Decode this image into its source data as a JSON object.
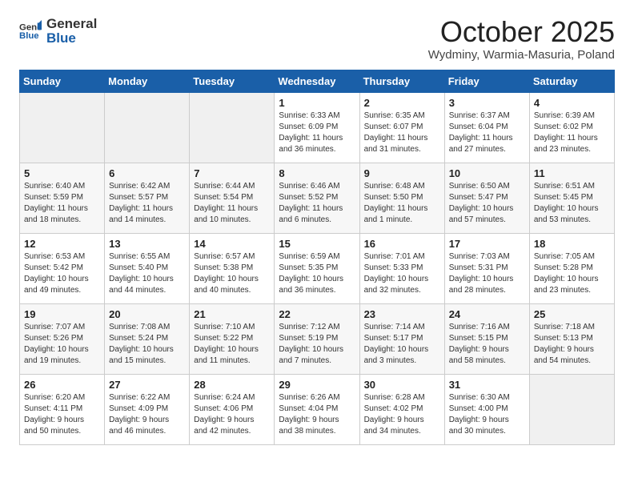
{
  "header": {
    "logo_general": "General",
    "logo_blue": "Blue",
    "title": "October 2025",
    "subtitle": "Wydminy, Warmia-Masuria, Poland"
  },
  "weekdays": [
    "Sunday",
    "Monday",
    "Tuesday",
    "Wednesday",
    "Thursday",
    "Friday",
    "Saturday"
  ],
  "weeks": [
    [
      {
        "day": "",
        "content": ""
      },
      {
        "day": "",
        "content": ""
      },
      {
        "day": "",
        "content": ""
      },
      {
        "day": "1",
        "content": "Sunrise: 6:33 AM\nSunset: 6:09 PM\nDaylight: 11 hours\nand 36 minutes."
      },
      {
        "day": "2",
        "content": "Sunrise: 6:35 AM\nSunset: 6:07 PM\nDaylight: 11 hours\nand 31 minutes."
      },
      {
        "day": "3",
        "content": "Sunrise: 6:37 AM\nSunset: 6:04 PM\nDaylight: 11 hours\nand 27 minutes."
      },
      {
        "day": "4",
        "content": "Sunrise: 6:39 AM\nSunset: 6:02 PM\nDaylight: 11 hours\nand 23 minutes."
      }
    ],
    [
      {
        "day": "5",
        "content": "Sunrise: 6:40 AM\nSunset: 5:59 PM\nDaylight: 11 hours\nand 18 minutes."
      },
      {
        "day": "6",
        "content": "Sunrise: 6:42 AM\nSunset: 5:57 PM\nDaylight: 11 hours\nand 14 minutes."
      },
      {
        "day": "7",
        "content": "Sunrise: 6:44 AM\nSunset: 5:54 PM\nDaylight: 11 hours\nand 10 minutes."
      },
      {
        "day": "8",
        "content": "Sunrise: 6:46 AM\nSunset: 5:52 PM\nDaylight: 11 hours\nand 6 minutes."
      },
      {
        "day": "9",
        "content": "Sunrise: 6:48 AM\nSunset: 5:50 PM\nDaylight: 11 hours\nand 1 minute."
      },
      {
        "day": "10",
        "content": "Sunrise: 6:50 AM\nSunset: 5:47 PM\nDaylight: 10 hours\nand 57 minutes."
      },
      {
        "day": "11",
        "content": "Sunrise: 6:51 AM\nSunset: 5:45 PM\nDaylight: 10 hours\nand 53 minutes."
      }
    ],
    [
      {
        "day": "12",
        "content": "Sunrise: 6:53 AM\nSunset: 5:42 PM\nDaylight: 10 hours\nand 49 minutes."
      },
      {
        "day": "13",
        "content": "Sunrise: 6:55 AM\nSunset: 5:40 PM\nDaylight: 10 hours\nand 44 minutes."
      },
      {
        "day": "14",
        "content": "Sunrise: 6:57 AM\nSunset: 5:38 PM\nDaylight: 10 hours\nand 40 minutes."
      },
      {
        "day": "15",
        "content": "Sunrise: 6:59 AM\nSunset: 5:35 PM\nDaylight: 10 hours\nand 36 minutes."
      },
      {
        "day": "16",
        "content": "Sunrise: 7:01 AM\nSunset: 5:33 PM\nDaylight: 10 hours\nand 32 minutes."
      },
      {
        "day": "17",
        "content": "Sunrise: 7:03 AM\nSunset: 5:31 PM\nDaylight: 10 hours\nand 28 minutes."
      },
      {
        "day": "18",
        "content": "Sunrise: 7:05 AM\nSunset: 5:28 PM\nDaylight: 10 hours\nand 23 minutes."
      }
    ],
    [
      {
        "day": "19",
        "content": "Sunrise: 7:07 AM\nSunset: 5:26 PM\nDaylight: 10 hours\nand 19 minutes."
      },
      {
        "day": "20",
        "content": "Sunrise: 7:08 AM\nSunset: 5:24 PM\nDaylight: 10 hours\nand 15 minutes."
      },
      {
        "day": "21",
        "content": "Sunrise: 7:10 AM\nSunset: 5:22 PM\nDaylight: 10 hours\nand 11 minutes."
      },
      {
        "day": "22",
        "content": "Sunrise: 7:12 AM\nSunset: 5:19 PM\nDaylight: 10 hours\nand 7 minutes."
      },
      {
        "day": "23",
        "content": "Sunrise: 7:14 AM\nSunset: 5:17 PM\nDaylight: 10 hours\nand 3 minutes."
      },
      {
        "day": "24",
        "content": "Sunrise: 7:16 AM\nSunset: 5:15 PM\nDaylight: 9 hours\nand 58 minutes."
      },
      {
        "day": "25",
        "content": "Sunrise: 7:18 AM\nSunset: 5:13 PM\nDaylight: 9 hours\nand 54 minutes."
      }
    ],
    [
      {
        "day": "26",
        "content": "Sunrise: 6:20 AM\nSunset: 4:11 PM\nDaylight: 9 hours\nand 50 minutes."
      },
      {
        "day": "27",
        "content": "Sunrise: 6:22 AM\nSunset: 4:09 PM\nDaylight: 9 hours\nand 46 minutes."
      },
      {
        "day": "28",
        "content": "Sunrise: 6:24 AM\nSunset: 4:06 PM\nDaylight: 9 hours\nand 42 minutes."
      },
      {
        "day": "29",
        "content": "Sunrise: 6:26 AM\nSunset: 4:04 PM\nDaylight: 9 hours\nand 38 minutes."
      },
      {
        "day": "30",
        "content": "Sunrise: 6:28 AM\nSunset: 4:02 PM\nDaylight: 9 hours\nand 34 minutes."
      },
      {
        "day": "31",
        "content": "Sunrise: 6:30 AM\nSunset: 4:00 PM\nDaylight: 9 hours\nand 30 minutes."
      },
      {
        "day": "",
        "content": ""
      }
    ]
  ]
}
